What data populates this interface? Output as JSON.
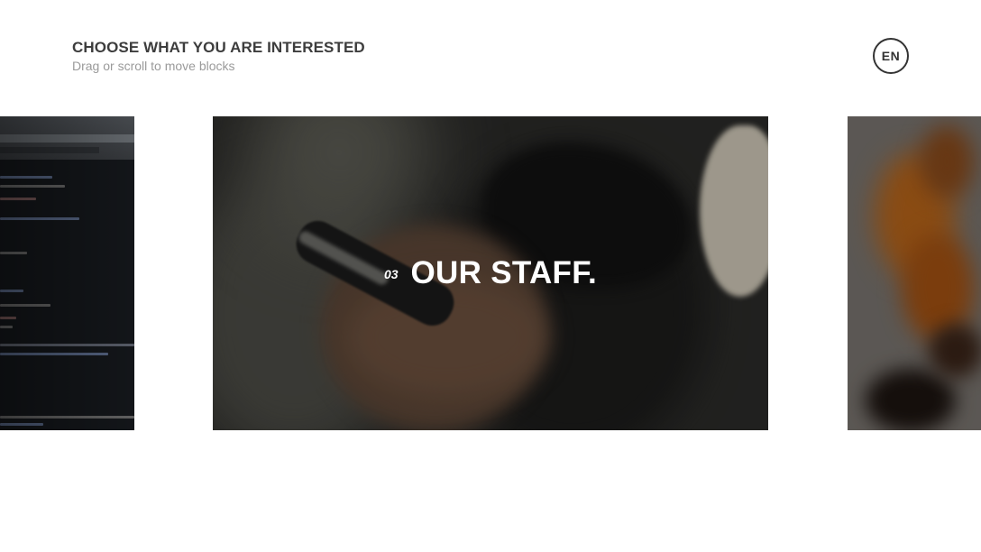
{
  "header": {
    "title": "CHOOSE WHAT YOU ARE INTERESTED",
    "subtitle": "Drag or scroll to move blocks"
  },
  "language": {
    "label": "EN"
  },
  "blocks": [
    {
      "image": "code-editor-photo"
    },
    {
      "number": "03",
      "title": "OUR STAFF.",
      "image": "hands-holding-phone-photo"
    },
    {
      "image": "orange-smoke-photo"
    }
  ],
  "colors": {
    "title": "#3d3d3d",
    "subtitle": "#9a9a9a",
    "background": "#ffffff",
    "overlay_text": "#ffffff"
  }
}
